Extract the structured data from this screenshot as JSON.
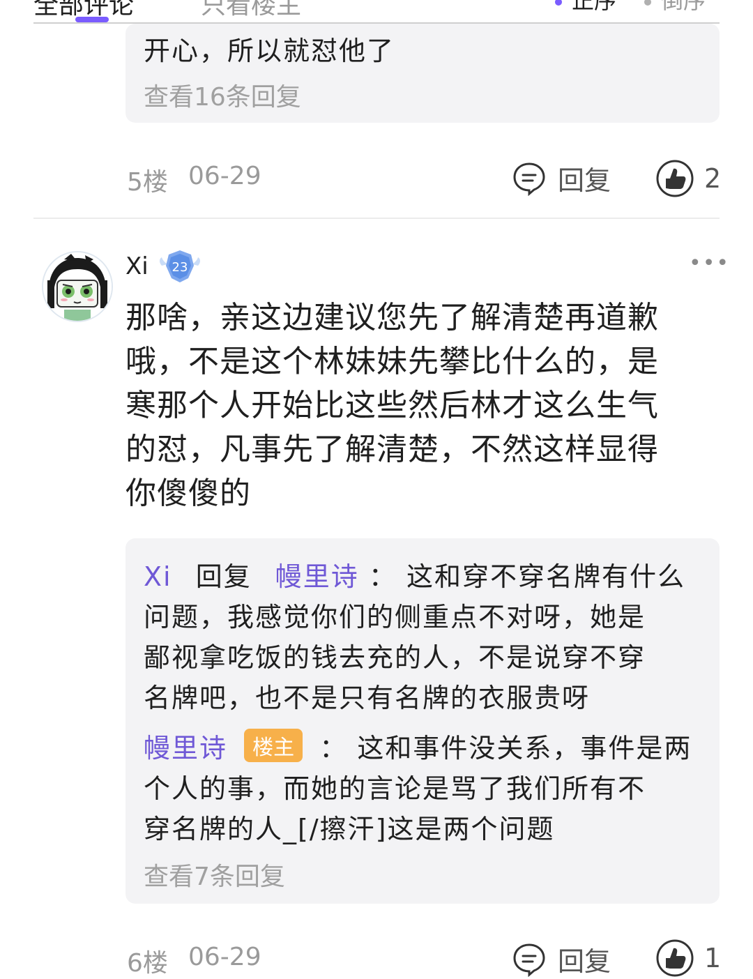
{
  "tabs": {
    "all_comments": "全部评论",
    "only_op": "只看楼主"
  },
  "sort": {
    "asc": "正序",
    "desc": "倒序"
  },
  "prev_comment": {
    "reply_tail": "开心，所以就怼他了",
    "view_replies": "查看16条回复",
    "floor": "5楼",
    "date": "06-29",
    "reply_label": "回复",
    "likes": "2"
  },
  "comment": {
    "username": "Xi",
    "level": "23",
    "more": "•••",
    "body_lines": [
      "那啥，亲这边建议您先了解清楚再道歉",
      "哦，不是这个林妹妹先攀比什么的，是",
      "寒那个人开始比这些然后林才这么生气",
      "的怼，凡事先了解清楚，不然这样显得",
      "你傻傻的"
    ],
    "replies": [
      {
        "author": "Xi",
        "verb": "回复",
        "target": "幔里诗",
        "colon": "：",
        "lines": [
          "这和穿不穿名牌有什么",
          "问题，我感觉你们的侧重点不对呀，她是",
          "鄙视拿吃饭的钱去充的人，不是说穿不穿",
          "名牌吧，也不是只有名牌的衣服贵呀"
        ]
      },
      {
        "author": "幔里诗",
        "tag": "楼主",
        "colon": "：",
        "lines": [
          "这和事件没关系，事件是两",
          "个人的事，而她的言论是骂了我们所有不",
          "穿名牌的人_[/擦汗]这是两个问题"
        ]
      }
    ],
    "view_replies": "查看7条回复",
    "floor": "6楼",
    "date": "06-29",
    "reply_label": "回复",
    "likes": "1"
  },
  "colors": {
    "accent": "#7a5cff",
    "username_purple": "#6f58d6",
    "op_tag": "#f7b04a"
  }
}
